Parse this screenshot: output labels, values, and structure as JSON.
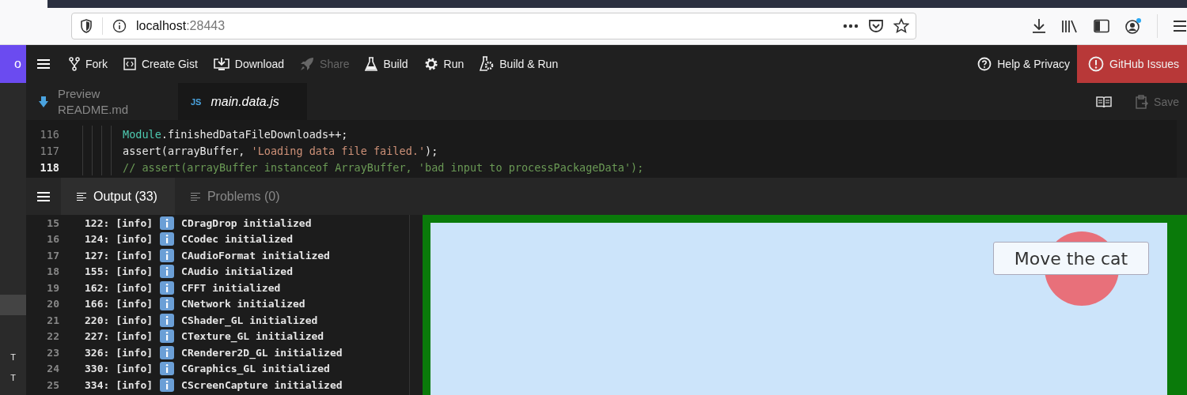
{
  "browser": {
    "url_host": "localhost",
    "url_port": ":28443",
    "profile_badge": true
  },
  "app_toolbar": {
    "brand_fragment": "o",
    "buttons": [
      {
        "label": "Fork",
        "disabled": false
      },
      {
        "label": "Create Gist",
        "disabled": false
      },
      {
        "label": "Download",
        "disabled": false
      },
      {
        "label": "Share",
        "disabled": true
      },
      {
        "label": "Build",
        "disabled": false
      },
      {
        "label": "Run",
        "disabled": false
      },
      {
        "label": "Build & Run",
        "disabled": false
      }
    ],
    "right_buttons": [
      {
        "label": "Help & Privacy",
        "kind": "plain"
      },
      {
        "label": "GitHub Issues",
        "kind": "danger"
      }
    ]
  },
  "sidebar": {
    "items": [
      {
        "selected": true
      },
      {
        "label": "T",
        "selected": false
      },
      {
        "label": "T",
        "selected": false
      }
    ]
  },
  "editor_tabs": [
    {
      "kind": "preview",
      "line1": "Preview",
      "line2": "README.md",
      "selected": false
    },
    {
      "kind": "file",
      "badge": "JS",
      "label": "main.data.js",
      "selected": true
    }
  ],
  "editor_actions": [
    {
      "label": "Save",
      "disabled": true
    }
  ],
  "code_lines": [
    {
      "number": "116",
      "current": false,
      "tokens": [
        {
          "text": "Module",
          "kind": "type"
        },
        {
          "text": ".finishedDataFileDownloads++;",
          "kind": "plain"
        }
      ]
    },
    {
      "number": "117",
      "current": false,
      "tokens": [
        {
          "text": "assert(arrayBuffer, ",
          "kind": "plain"
        },
        {
          "text": "'Loading data file failed.'",
          "kind": "string"
        },
        {
          "text": ");",
          "kind": "plain"
        }
      ]
    },
    {
      "number": "118",
      "current": true,
      "tokens": [
        {
          "text": "// assert(arrayBuffer instanceof ArrayBuffer, 'bad input to processPackageData');",
          "kind": "comment"
        }
      ]
    }
  ],
  "panel_tabs": [
    {
      "label": "Output (33)",
      "selected": true
    },
    {
      "label": "Problems (0)",
      "selected": false
    }
  ],
  "log_lines": [
    {
      "number": "15",
      "prefix": "122: [info]",
      "message": "CDragDrop initialized"
    },
    {
      "number": "16",
      "prefix": "124: [info]",
      "message": "CCodec initialized"
    },
    {
      "number": "17",
      "prefix": "127: [info]",
      "message": "CAudioFormat initialized"
    },
    {
      "number": "18",
      "prefix": "155: [info]",
      "message": "CAudio initialized"
    },
    {
      "number": "19",
      "prefix": "162: [info]",
      "message": "CFFT initialized"
    },
    {
      "number": "20",
      "prefix": "166: [info]",
      "message": "CNetwork initialized"
    },
    {
      "number": "21",
      "prefix": "220: [info]",
      "message": "CShader_GL initialized"
    },
    {
      "number": "22",
      "prefix": "227: [info]",
      "message": "CTexture_GL initialized"
    },
    {
      "number": "23",
      "prefix": "326: [info]",
      "message": "CRenderer2D_GL initialized"
    },
    {
      "number": "24",
      "prefix": "330: [info]",
      "message": "CGraphics_GL initialized"
    },
    {
      "number": "25",
      "prefix": "334: [info]",
      "message": "CScreenCapture initialized"
    }
  ],
  "preview": {
    "button": "Move the cat"
  }
}
